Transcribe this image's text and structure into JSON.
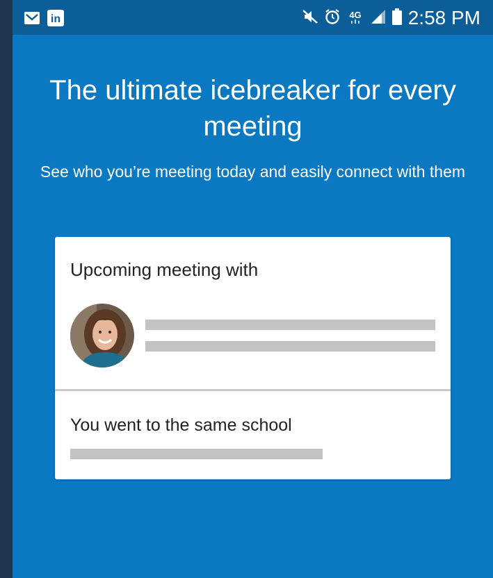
{
  "status_bar": {
    "time": "2:58 PM",
    "network": "4G",
    "left_icons": [
      "mail-icon",
      "linkedin-icon"
    ],
    "linkedin_glyph": "in",
    "right_icons": [
      "mute-icon",
      "alarm-icon",
      "network-4g-icon",
      "signal-icon",
      "battery-icon"
    ]
  },
  "onboarding": {
    "headline": "The ultimate icebreaker for every meeting",
    "subhead": "See who you’re meeting today and easily connect with them"
  },
  "card": {
    "title": "Upcoming meeting with",
    "shared_title": "You went to the same school"
  },
  "colors": {
    "background": "#0a79c2",
    "status_bar": "#0b5e97",
    "card": "#ffffff",
    "placeholder": "#c3c3c3",
    "frame": "#1f3550"
  }
}
